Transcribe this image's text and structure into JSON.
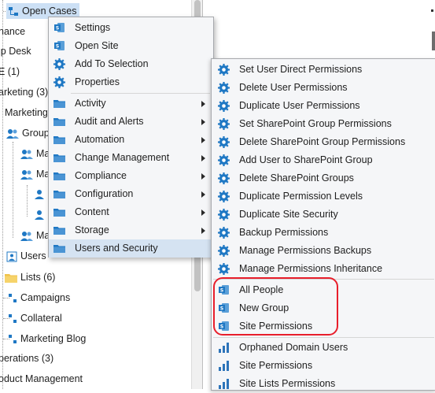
{
  "tree": {
    "items": [
      {
        "label": "Open Cases",
        "selected": true
      },
      {
        "label": "nance"
      },
      {
        "label": "lp Desk"
      },
      {
        "label": "E (1)"
      },
      {
        "label": "arketing (3)"
      },
      {
        "label": "Marketing"
      },
      {
        "label": "Group"
      },
      {
        "label": "Ma"
      },
      {
        "label": "Ma"
      },
      {
        "label": "Ma"
      },
      {
        "label": "Users"
      },
      {
        "label": "Lists (6)"
      },
      {
        "label": "Campaigns"
      },
      {
        "label": "Collateral"
      },
      {
        "label": "Marketing Blog"
      },
      {
        "label": "perations (3)"
      },
      {
        "label": "oduct Management"
      }
    ]
  },
  "context_menu": {
    "items": [
      {
        "label": "Settings",
        "icon": "sharepoint-icon"
      },
      {
        "label": "Open Site",
        "icon": "sharepoint-icon"
      },
      {
        "label": "Add To Selection",
        "icon": "gear-icon"
      },
      {
        "label": "Properties",
        "icon": "gear-icon"
      },
      {
        "label": "Activity",
        "icon": "folder-icon",
        "submenu": true
      },
      {
        "label": "Audit and Alerts",
        "icon": "folder-icon",
        "submenu": true
      },
      {
        "label": "Automation",
        "icon": "folder-icon",
        "submenu": true
      },
      {
        "label": "Change Management",
        "icon": "folder-icon",
        "submenu": true
      },
      {
        "label": "Compliance",
        "icon": "folder-icon",
        "submenu": true
      },
      {
        "label": "Configuration",
        "icon": "folder-icon",
        "submenu": true
      },
      {
        "label": "Content",
        "icon": "folder-icon",
        "submenu": true
      },
      {
        "label": "Storage",
        "icon": "folder-icon",
        "submenu": true
      },
      {
        "label": "Users and Security",
        "icon": "folder-icon",
        "highlighted": true
      }
    ]
  },
  "submenu": {
    "items": [
      {
        "label": "Set User Direct Permissions",
        "icon": "gear-icon"
      },
      {
        "label": "Delete User Permissions",
        "icon": "gear-icon"
      },
      {
        "label": "Duplicate User Permissions",
        "icon": "gear-icon"
      },
      {
        "label": "Set SharePoint Group Permissions",
        "icon": "gear-icon"
      },
      {
        "label": "Delete SharePoint Group Permissions",
        "icon": "gear-icon"
      },
      {
        "label": "Add User to SharePoint Group",
        "icon": "gear-icon"
      },
      {
        "label": "Delete SharePoint Groups",
        "icon": "gear-icon"
      },
      {
        "label": "Duplicate Permission Levels",
        "icon": "gear-icon"
      },
      {
        "label": "Duplicate Site Security",
        "icon": "gear-icon"
      },
      {
        "label": "Backup Permissions",
        "icon": "gear-icon"
      },
      {
        "label": "Manage Permissions Backups",
        "icon": "gear-icon"
      },
      {
        "label": "Manage Permissions Inheritance",
        "icon": "gear-icon"
      },
      {
        "label": "All People",
        "icon": "sharepoint-icon"
      },
      {
        "label": "New Group",
        "icon": "sharepoint-icon"
      },
      {
        "label": "Site Permissions",
        "icon": "sharepoint-icon"
      },
      {
        "label": "Orphaned Domain Users",
        "icon": "bar-chart-icon"
      },
      {
        "label": "Site Permissions",
        "icon": "bar-chart-icon"
      },
      {
        "label": "Site Lists Permissions",
        "icon": "bar-chart-icon"
      }
    ]
  },
  "colors": {
    "accent": "#1f78c4",
    "menu_highlight": "#d5e3f2",
    "annotation": "#e81e2b",
    "folder": "#f0c24b"
  }
}
